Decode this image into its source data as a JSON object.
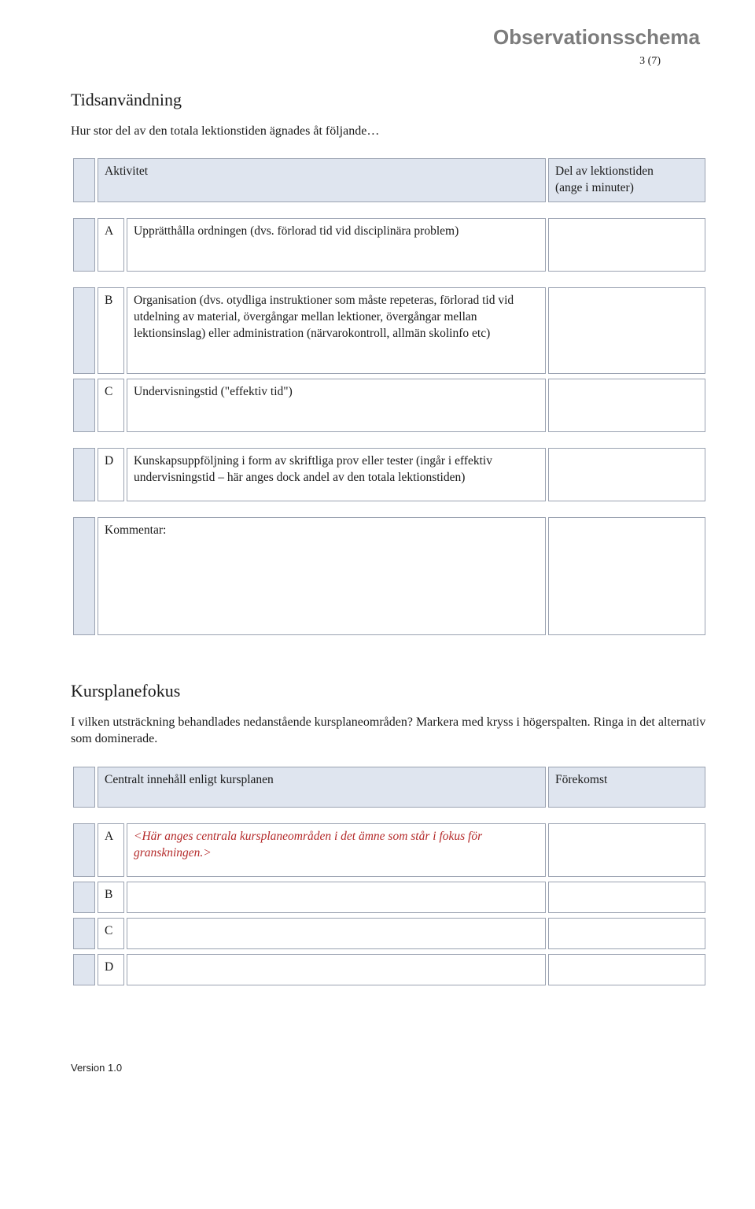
{
  "header": {
    "doc_title": "Observationsschema",
    "page_indicator": "3 (7)"
  },
  "section1": {
    "title": "Tidsanvändning",
    "desc": "Hur stor del av den totala lektionstiden ägnades åt följande…",
    "col_activity": "Aktivitet",
    "col_value_l1": "Del av lektionstiden",
    "col_value_l2": "(ange i minuter)",
    "rows": {
      "A": {
        "label": "A",
        "text": "Upprätthålla ordningen (dvs. förlorad tid vid disciplinära problem)"
      },
      "B": {
        "label": "B",
        "text": "Organisation (dvs. otydliga instruktioner som måste repeteras, förlorad tid vid utdelning av material, övergångar mellan lektioner, övergångar mellan lektionsinslag) eller administration (närvarokontroll, allmän skolinfo etc)"
      },
      "C": {
        "label": "C",
        "text": "Undervisningstid (\"effektiv tid\")"
      },
      "D": {
        "label": "D",
        "text": "Kunskapsuppföljning i form av skriftliga prov eller tester (ingår i effektiv undervisningstid – här anges dock andel av den totala lektionstiden)"
      },
      "comment": {
        "text": "Kommentar:"
      }
    }
  },
  "section2": {
    "title": "Kursplanefokus",
    "desc": "I vilken utsträckning behandlades nedanstående kursplaneområden? Markera med kryss i högerspalten. Ringa in det alternativ som dominerade.",
    "col_area": "Centralt innehåll enligt kursplanen",
    "col_occ": "Förekomst",
    "rows": {
      "A": {
        "label": "A",
        "placeholder": "<Här anges centrala kursplaneområden i det ämne som står i fokus för granskningen.>"
      },
      "B": {
        "label": "B"
      },
      "C": {
        "label": "C"
      },
      "D": {
        "label": "D"
      }
    }
  },
  "footer": {
    "version": "Version 1.0"
  }
}
